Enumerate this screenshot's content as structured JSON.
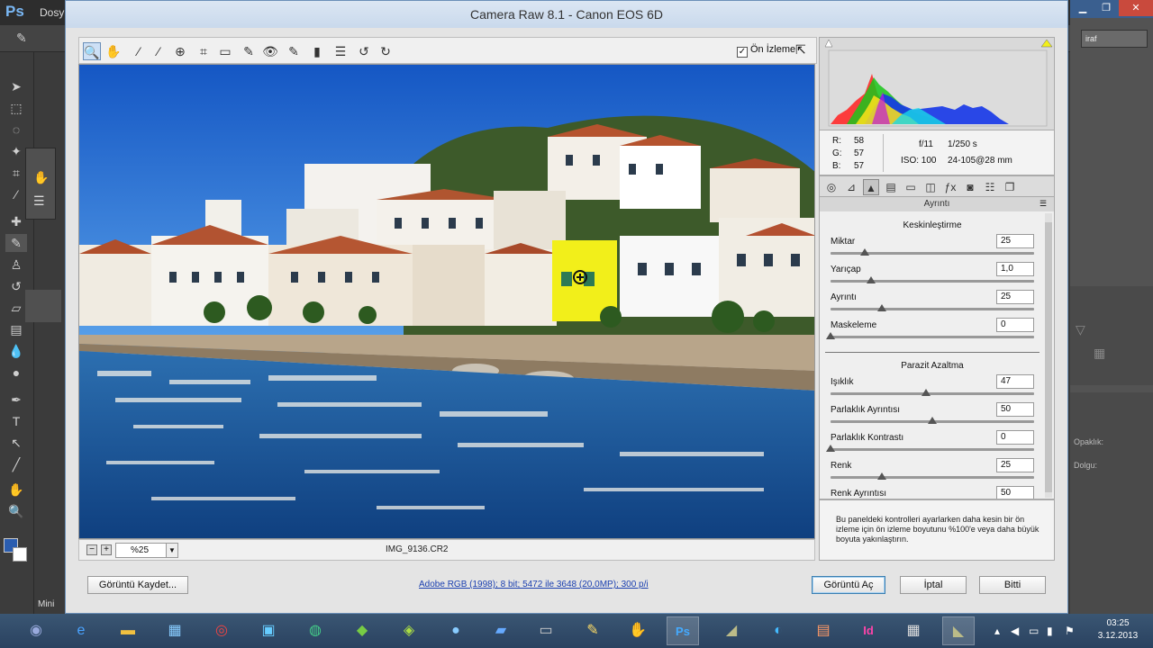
{
  "photoshop": {
    "logo": "Ps",
    "menu_first": "Dosy",
    "mini_label": "Mini",
    "right_dropdown": "iraf",
    "right_label_1": "Opaklık:",
    "right_label_2": "Dolgu:",
    "tools": [
      "move-icon",
      "marquee-icon",
      "lasso-icon",
      "magic-wand-icon",
      "crop-icon",
      "eyedropper-icon",
      "healing-icon",
      "brush-icon",
      "stamp-icon",
      "history-brush-icon",
      "eraser-icon",
      "gradient-icon",
      "blur-icon",
      "dodge-icon",
      "pen-icon",
      "type-icon",
      "path-select-icon",
      "line-icon",
      "hand-icon",
      "zoom-icon"
    ]
  },
  "dialog": {
    "title": "Camera Raw 8.1  -  Canon EOS 6D",
    "preview_label": "Ön İzleme",
    "preview_checked": "✓",
    "zoom": "%25",
    "filename": "IMG_9136.CR2",
    "histogram": {
      "r": "R:",
      "r_val": "58",
      "g": "G:",
      "g_val": "57",
      "b": "B:",
      "b_val": "57",
      "aperture": "f/11",
      "shutter": "1/250 s",
      "iso": "ISO: 100",
      "lens": "24-105@28 mm"
    },
    "panel_title": "Ayrıntı",
    "sharpening": {
      "title": "Keskinleştirme",
      "sliders": [
        {
          "label": "Miktar",
          "value": "25",
          "fraction": 0.17
        },
        {
          "label": "Yarıçap",
          "value": "1,0",
          "fraction": 0.2
        },
        {
          "label": "Ayrıntı",
          "value": "25",
          "fraction": 0.25
        },
        {
          "label": "Maskeleme",
          "value": "0",
          "fraction": 0.0
        }
      ]
    },
    "noise": {
      "title": "Parazit Azaltma",
      "sliders": [
        {
          "label": "Işıklık",
          "value": "47",
          "fraction": 0.47
        },
        {
          "label": "Parlaklık Ayrıntısı",
          "value": "50",
          "fraction": 0.5
        },
        {
          "label": "Parlaklık Kontrastı",
          "value": "0",
          "fraction": 0.0
        },
        {
          "label": "Renk",
          "value": "25",
          "fraction": 0.25
        },
        {
          "label": "Renk Ayrıntısı",
          "value": "50",
          "fraction": 0.5
        }
      ]
    },
    "help_text": "Bu paneldeki kontrolleri ayarlarken daha kesin bir ön izleme için ön izleme boyutunu %100'e veya daha büyük boyuta yakınlaştırın.",
    "save_button": "Görüntü Kaydet...",
    "workflow_link": "Adobe RGB (1998); 8 bit; 5472 ile 3648 (20,0MP); 300 p/i",
    "open_button": "Görüntü Aç",
    "cancel_button": "İptal",
    "done_button": "Bitti"
  },
  "taskbar": {
    "time": "03:25",
    "date": "3.12.2013",
    "items": [
      "pcp",
      "ie",
      "explorer",
      "network",
      "chrome",
      "apg",
      "globe",
      "app-green",
      "avp",
      "monitor",
      "app-doc",
      "app-yellow",
      "photoshop",
      "app-gray",
      "app-blue",
      "app-books",
      "indesign",
      "calculator",
      "app-tool"
    ]
  },
  "colors": {
    "accent": "#6b8fb8",
    "sky": "#1f6fd0",
    "highlight": "#f2ef1a"
  }
}
